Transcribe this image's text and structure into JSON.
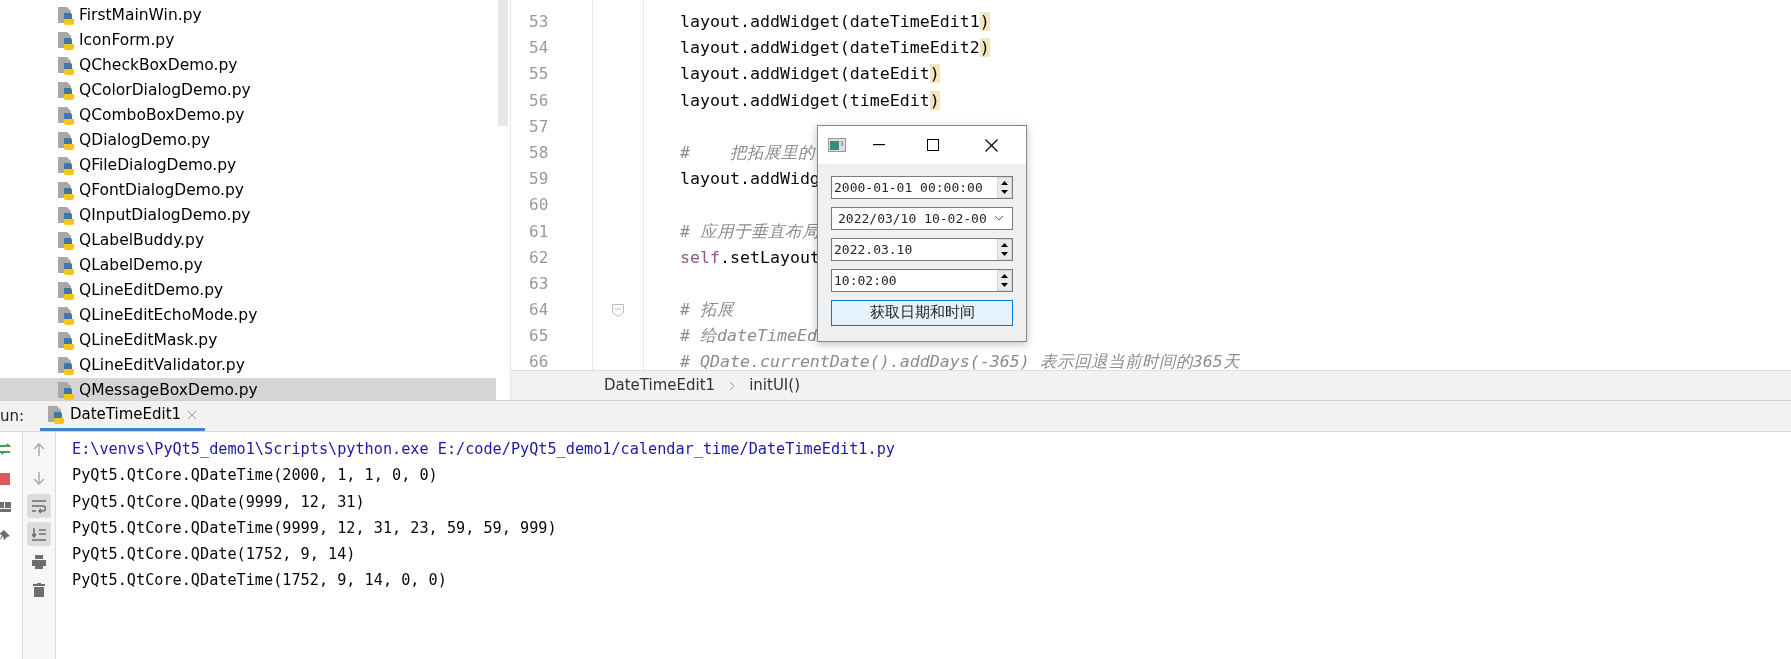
{
  "project_tree": {
    "items": [
      {
        "label": "FirstMainWin.py",
        "selected": false
      },
      {
        "label": "IconForm.py",
        "selected": false
      },
      {
        "label": "QCheckBoxDemo.py",
        "selected": false
      },
      {
        "label": "QColorDialogDemo.py",
        "selected": false
      },
      {
        "label": "QComboBoxDemo.py",
        "selected": false
      },
      {
        "label": "QDialogDemo.py",
        "selected": false
      },
      {
        "label": "QFileDialogDemo.py",
        "selected": false
      },
      {
        "label": "QFontDialogDemo.py",
        "selected": false
      },
      {
        "label": "QInputDialogDemo.py",
        "selected": false
      },
      {
        "label": "QLabelBuddy.py",
        "selected": false
      },
      {
        "label": "QLabelDemo.py",
        "selected": false
      },
      {
        "label": "QLineEditDemo.py",
        "selected": false
      },
      {
        "label": "QLineEditEchoMode.py",
        "selected": false
      },
      {
        "label": "QLineEditMask.py",
        "selected": false
      },
      {
        "label": "QLineEditValidator.py",
        "selected": false
      },
      {
        "label": "QMessageBoxDemo.py",
        "selected": true
      }
    ]
  },
  "editor": {
    "lines": [
      {
        "number": "53",
        "fold": false,
        "segments": [
          {
            "text": "layout.addWidget(dateTimeEdit1",
            "kind": "plain"
          },
          {
            "text": ")",
            "kind": "matched_bracket"
          }
        ]
      },
      {
        "number": "54",
        "fold": false,
        "segments": [
          {
            "text": "layout.addWidget(dateTimeEdit2",
            "kind": "plain"
          },
          {
            "text": ")",
            "kind": "matched_bracket"
          }
        ]
      },
      {
        "number": "55",
        "fold": false,
        "segments": [
          {
            "text": "layout.addWidget(dateEdit",
            "kind": "plain"
          },
          {
            "text": ")",
            "kind": "matched_bracket"
          }
        ]
      },
      {
        "number": "56",
        "fold": false,
        "segments": [
          {
            "text": "layout.addWidget(timeEdit",
            "kind": "plain"
          },
          {
            "text": ")",
            "kind": "matched_bracket"
          }
        ]
      },
      {
        "number": "57",
        "fold": false
      },
      {
        "number": "58",
        "fold": false,
        "segments": [
          {
            "text": "#    把拓展里的",
            "kind": "comment"
          }
        ]
      },
      {
        "number": "59",
        "fold": false,
        "segments": [
          {
            "text": "layout.addWidg",
            "kind": "plain"
          }
        ]
      },
      {
        "number": "60",
        "fold": false
      },
      {
        "number": "61",
        "fold": false,
        "segments": [
          {
            "text": "# 应用于垂直布局",
            "kind": "comment"
          }
        ]
      },
      {
        "number": "62",
        "fold": false,
        "segments": [
          {
            "text": "self",
            "kind": "keyword"
          },
          {
            "text": ".setLayout",
            "kind": "plain"
          }
        ]
      },
      {
        "number": "63",
        "fold": false
      },
      {
        "number": "64",
        "fold": true,
        "segments": [
          {
            "text": "# 拓展",
            "kind": "comment"
          }
        ]
      },
      {
        "number": "65",
        "fold": false,
        "segments": [
          {
            "text": "# 给dateTimeEd",
            "kind": "comment"
          }
        ]
      },
      {
        "number": "66",
        "fold": false,
        "segments": [
          {
            "text": "# QDate.currentDate().addDays(-365) 表示回退当前时间的365天",
            "kind": "comment"
          }
        ]
      }
    ]
  },
  "breadcrumb": [
    "DateTimeEdit1",
    "initUI()"
  ],
  "dialog": {
    "fields": [
      {
        "kind": "spinbox",
        "value": "2000-01-01 00:00:00"
      },
      {
        "kind": "dropdown",
        "value": "2022/03/10 10-02-00"
      },
      {
        "kind": "spinbox",
        "value": "2022.03.10"
      },
      {
        "kind": "spinbox",
        "value": "10:02:00"
      }
    ],
    "button": "获取日期和时间"
  },
  "run": {
    "label": "un:",
    "tabs": [
      {
        "label": "DateTimeEdit1",
        "selected": true
      }
    ],
    "left_tools": [
      {
        "kind": "rerun"
      },
      {
        "kind": "stop"
      },
      {
        "kind": "layout"
      },
      {
        "kind": "pin"
      }
    ],
    "tools": [
      {
        "kind": "up",
        "on": false
      },
      {
        "kind": "down",
        "on": false
      },
      {
        "kind": "wrap",
        "on": true
      },
      {
        "kind": "scroll_end",
        "on": true
      },
      {
        "kind": "print",
        "on": false
      },
      {
        "kind": "trash",
        "on": false
      }
    ],
    "output": [
      {
        "kind": "command",
        "text": "E:\\venvs\\PyQt5_demo1\\Scripts\\python.exe E:/code/PyQt5_demo1/calendar_time/DateTimeEdit1.py"
      },
      {
        "kind": "stdout",
        "text": "PyQt5.QtCore.QDateTime(2000, 1, 1, 0, 0)"
      },
      {
        "kind": "stdout",
        "text": "PyQt5.QtCore.QDate(9999, 12, 31)"
      },
      {
        "kind": "stdout",
        "text": "PyQt5.QtCore.QDateTime(9999, 12, 31, 23, 59, 59, 999)"
      },
      {
        "kind": "stdout",
        "text": "PyQt5.QtCore.QDate(1752, 9, 14)"
      },
      {
        "kind": "stdout",
        "text": "PyQt5.QtCore.QDateTime(1752, 9, 14, 0, 0)"
      }
    ]
  }
}
